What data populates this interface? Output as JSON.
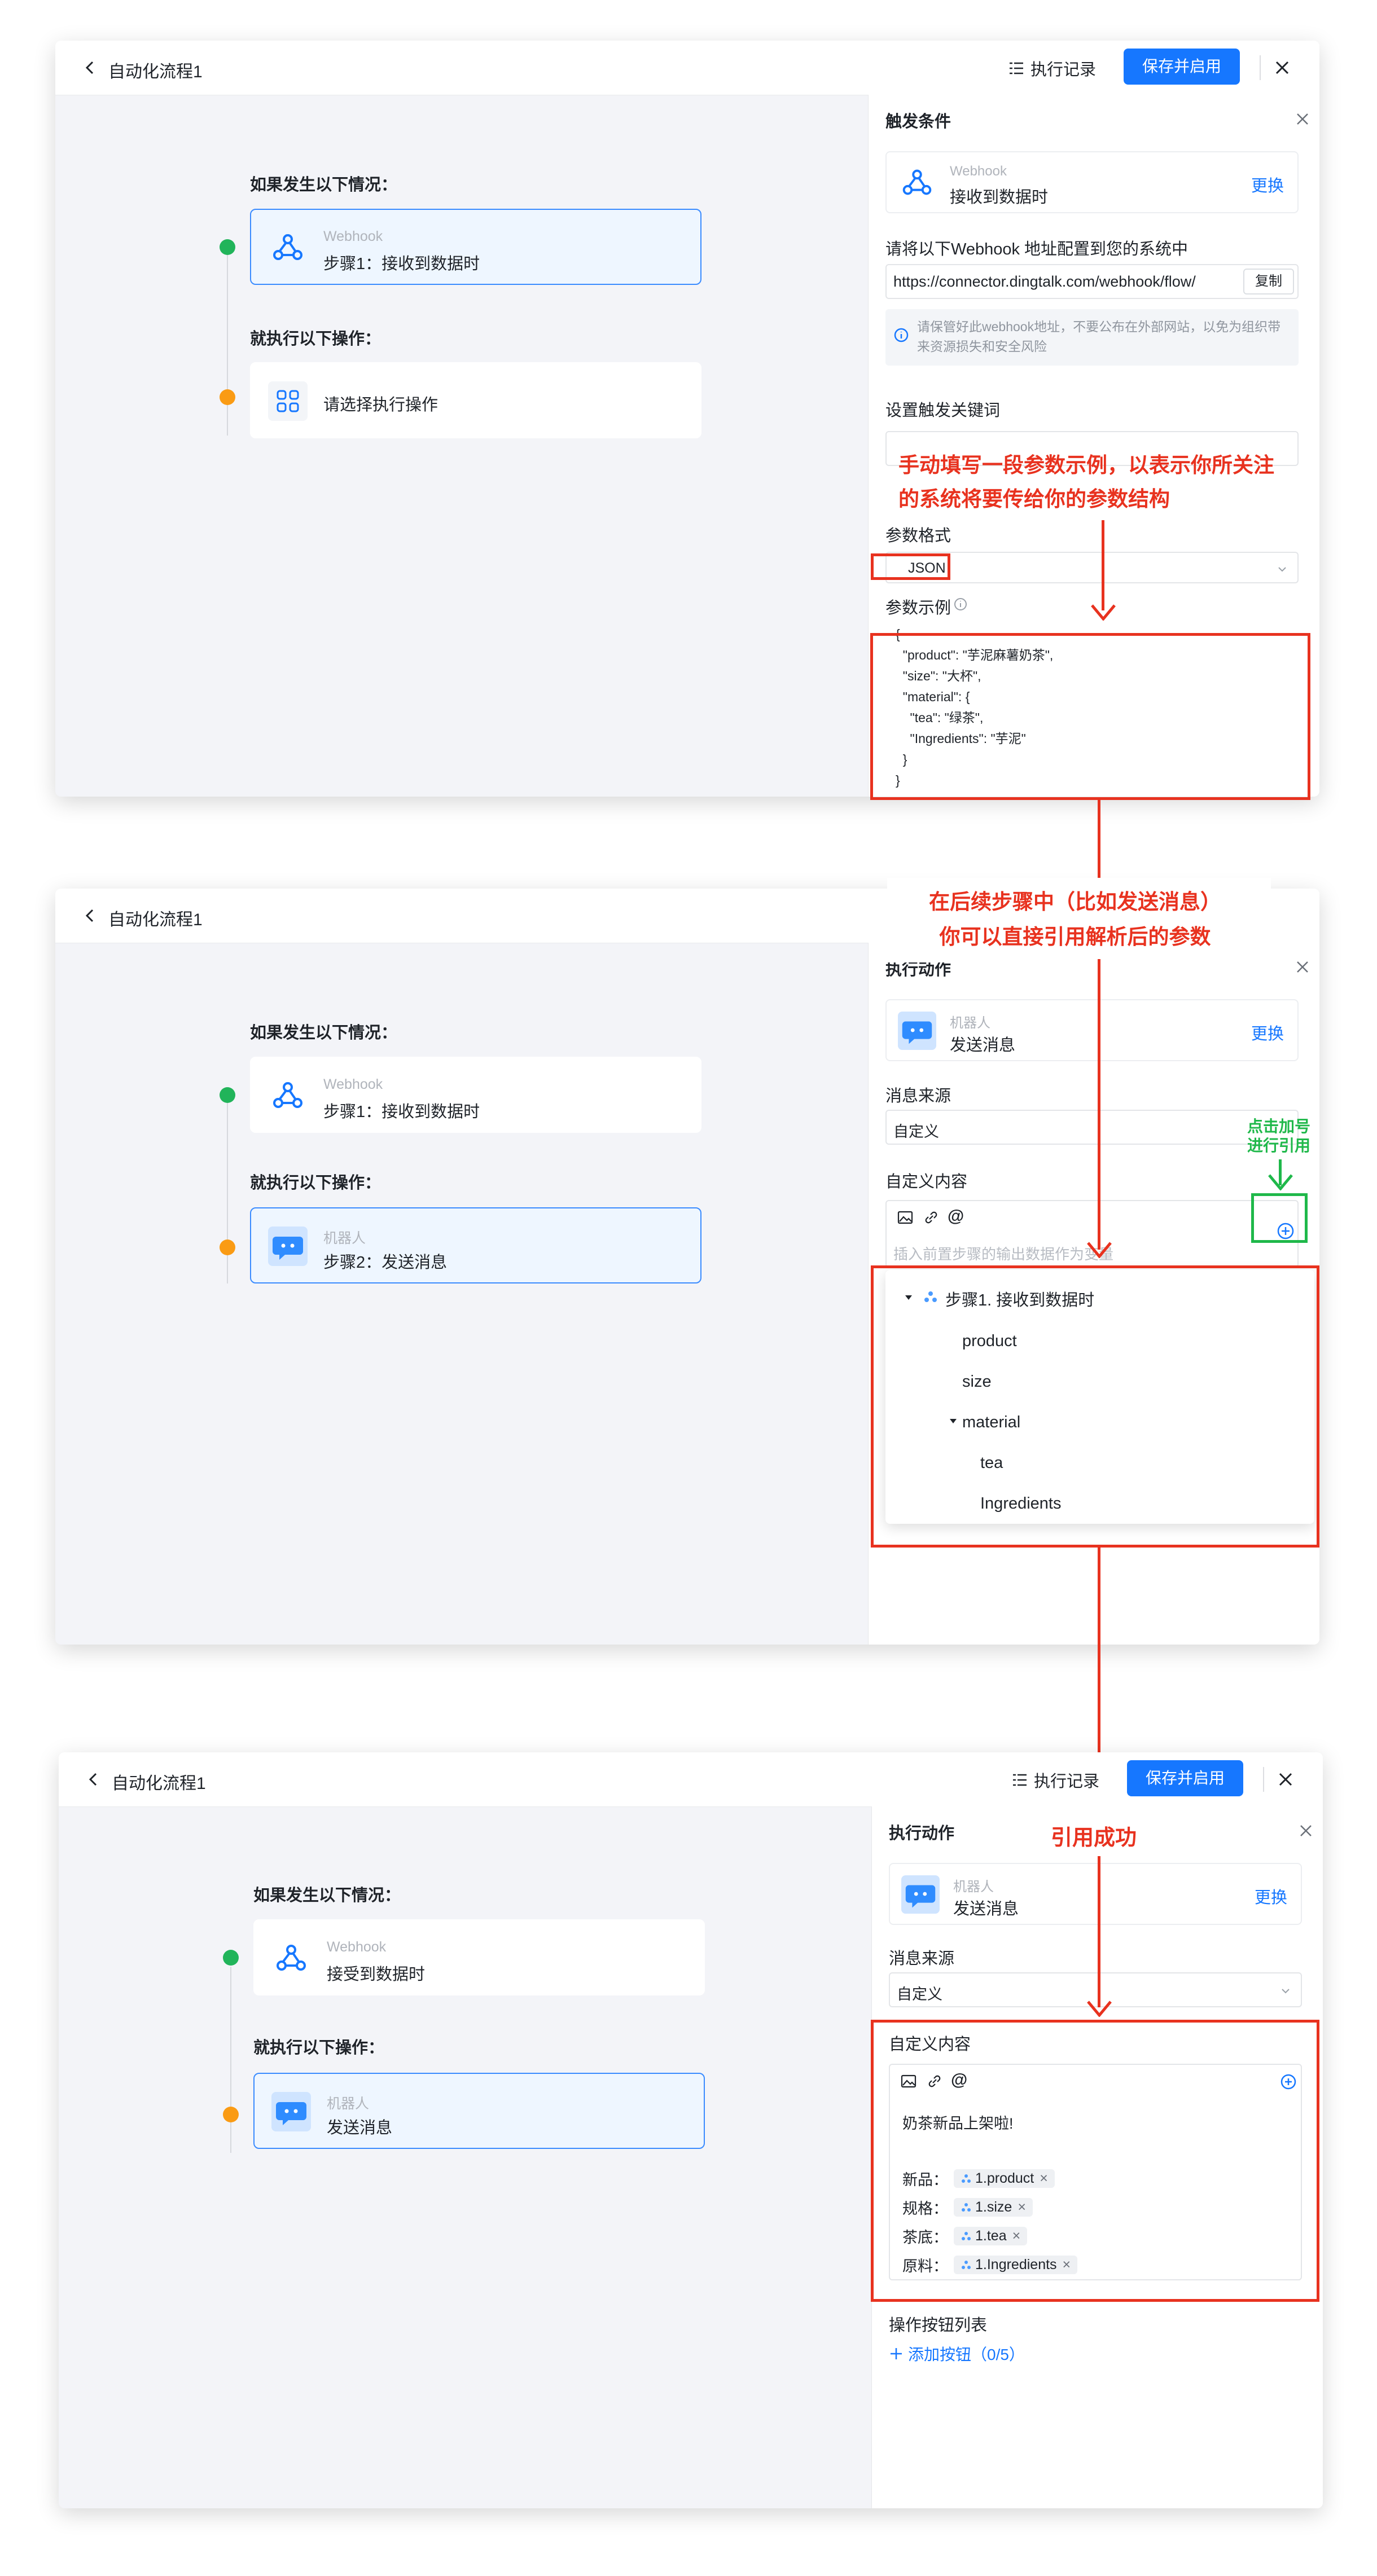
{
  "common": {
    "flow_title": "自动化流程1",
    "history_label": "执行记录",
    "save_label": "保存并启用",
    "if_label": "如果发生以下情况：",
    "then_label": "就执行以下操作：",
    "swap_label": "更换"
  },
  "panel1": {
    "trigger_node": {
      "sub": "Webhook",
      "main": "步骤1：接收到数据时"
    },
    "action_node": {
      "main": "请选择执行操作"
    },
    "side": {
      "title": "触发条件",
      "card_sub": "Webhook",
      "card_main": "接收到数据时",
      "config_label": "请将以下Webhook 地址配置到您的系统中",
      "url": "https://connector.dingtalk.com/webhook/flow/",
      "copy_label": "复制",
      "notice": "请保管好此webhook地址，不要公布在外部网站，以免为组织带来资源损失和安全风险",
      "keyword_label": "设置触发关键词",
      "format_label": "参数格式",
      "format_value": "JSON",
      "example_label": "参数示例",
      "example_lines": [
        "{",
        "  \"product\": \"芋泥麻薯奶茶\",",
        "  \"size\": \"大杯\",",
        "  \"material\": {",
        "    \"tea\": \"绿茶\",",
        "    \"Ingredients\": \"芋泥\"",
        "  }",
        "}"
      ]
    },
    "annotation": [
      "手动填写一段参数示例，以表示你所关注",
      "的系统将要传给你的参数结构"
    ]
  },
  "panel2": {
    "trigger_node": {
      "sub": "Webhook",
      "main": "步骤1：接收到数据时"
    },
    "action_node": {
      "sub": "机器人",
      "main": "步骤2：发送消息"
    },
    "annotation": [
      "在后续步骤中（比如发送消息）",
      "你可以直接引用解析后的参数"
    ],
    "green_annotation": [
      "点击加号",
      "进行引用"
    ],
    "side": {
      "title": "执行动作",
      "card_sub": "机器人",
      "card_main": "发送消息",
      "source_label": "消息来源",
      "source_value": "自定义",
      "content_label": "自定义内容",
      "placeholder": "插入前置步骤的输出数据作为变量",
      "tree_root": "步骤1. 接收到数据时",
      "tree_items": [
        "product",
        "size"
      ],
      "tree_group": "material",
      "tree_sub_items": [
        "tea",
        "Ingredients"
      ]
    }
  },
  "panel3": {
    "trigger_node": {
      "sub": "Webhook",
      "main": "接受到数据时"
    },
    "action_node": {
      "sub": "机器人",
      "main": "发送消息"
    },
    "annotation": "引用成功",
    "side": {
      "title": "执行动作",
      "card_sub": "机器人",
      "card_main": "发送消息",
      "source_label": "消息来源",
      "source_value": "自定义",
      "content_label": "自定义内容",
      "message_first_line": "奶茶新品上架啦!",
      "fields": [
        {
          "label": "新品：",
          "tag": "1.product"
        },
        {
          "label": "规格：",
          "tag": "1.size"
        },
        {
          "label": "茶底：",
          "tag": "1.tea"
        },
        {
          "label": "原料：",
          "tag": "1.Ingredients"
        }
      ],
      "buttons_label": "操作按钮列表",
      "add_button_label": "添加按钮（0/5）"
    }
  },
  "colors": {
    "primary": "#1677ff",
    "annotation_red": "#e8321f",
    "annotation_green": "#1fb84a",
    "success": "#21b45a",
    "warning": "#fa9b14"
  }
}
